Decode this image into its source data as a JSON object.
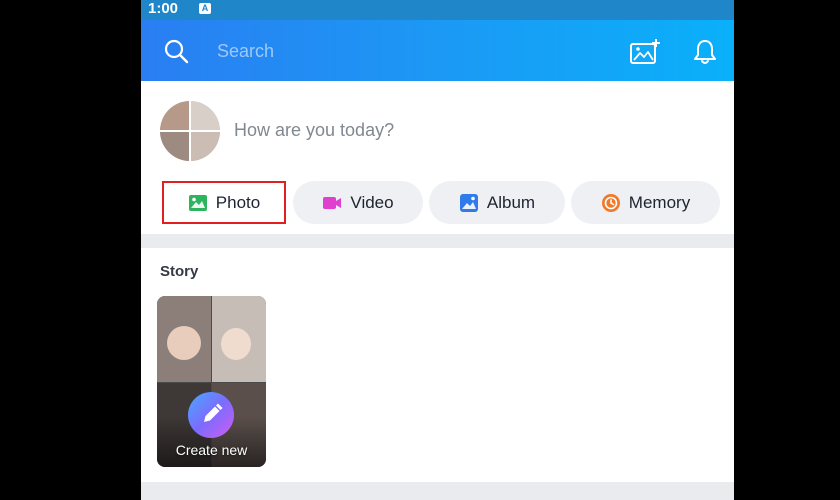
{
  "status_bar": {
    "time": "1:00",
    "notification_badge": "A"
  },
  "header": {
    "search_placeholder": "Search",
    "icons": [
      "search-icon",
      "add-photo-icon",
      "bell-icon"
    ]
  },
  "composer": {
    "prompt": "How are you today?",
    "actions": [
      {
        "label": "Photo",
        "icon": "photo-icon",
        "color": "#2db55d"
      },
      {
        "label": "Video",
        "icon": "video-icon",
        "color": "#e040d0"
      },
      {
        "label": "Album",
        "icon": "album-icon",
        "color": "#2f7bea"
      },
      {
        "label": "Memory",
        "icon": "memory-icon",
        "color": "#f07a2a"
      }
    ]
  },
  "story": {
    "title": "Story",
    "create_label": "Create new",
    "icon": "pencil-icon"
  },
  "colors": {
    "header_start": "#2a7ef2",
    "header_end": "#0ab0fa",
    "selected_outline": "#e02020"
  }
}
